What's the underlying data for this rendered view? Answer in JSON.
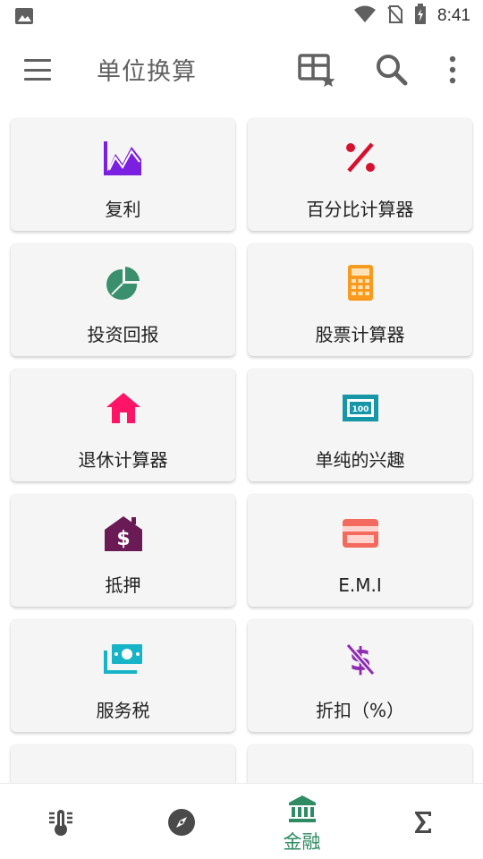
{
  "status_bar": {
    "time": "8:41"
  },
  "app_bar": {
    "title": "单位换算"
  },
  "grid": {
    "items": [
      {
        "label": "复利",
        "icon": "line-chart-icon",
        "color": "#7b1fe0"
      },
      {
        "label": "百分比计算器",
        "icon": "percent-icon",
        "color": "#d6102f"
      },
      {
        "label": "投资回报",
        "icon": "pie-chart-icon",
        "color": "#3a8f6e"
      },
      {
        "label": "股票计算器",
        "icon": "calculator-icon",
        "color": "#f79a1e"
      },
      {
        "label": "退休计算器",
        "icon": "home-icon",
        "color": "#ff1466"
      },
      {
        "label": "单纯的兴趣",
        "icon": "banknote-100-icon",
        "color": "#1796a8"
      },
      {
        "label": "抵押",
        "icon": "house-dollar-icon",
        "color": "#6a1a55"
      },
      {
        "label": "E.M.I",
        "icon": "credit-card-icon",
        "color": "#f46a5e"
      },
      {
        "label": "服务税",
        "icon": "money-stack-icon",
        "color": "#17b4c8"
      },
      {
        "label": "折扣（%）",
        "icon": "dollar-strike-icon",
        "color": "#8e2db3"
      },
      {
        "label": "",
        "icon": "partial-icon",
        "color": "#4a5e6b"
      },
      {
        "label": "",
        "icon": "partial-card-icon",
        "color": "#2e8b3e"
      }
    ]
  },
  "bottom_nav": {
    "items": [
      {
        "icon": "thermometer-icon",
        "label": ""
      },
      {
        "icon": "compass-icon",
        "label": ""
      },
      {
        "icon": "bank-icon",
        "label": "金融",
        "active": true
      },
      {
        "icon": "sigma-icon",
        "label": ""
      }
    ],
    "active_color": "#2e8b63"
  }
}
